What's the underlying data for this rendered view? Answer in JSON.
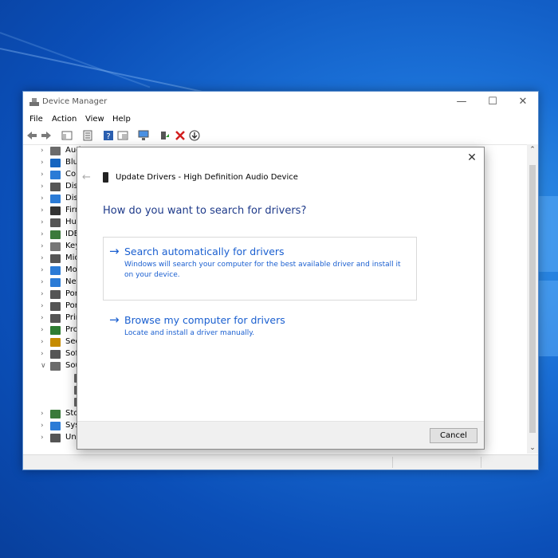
{
  "window": {
    "title": "Device Manager",
    "menu": [
      "File",
      "Action",
      "View",
      "Help"
    ]
  },
  "tree": [
    {
      "label": "Aud",
      "chev": ">",
      "icon": "speaker-icon",
      "color": "#6b6b6b"
    },
    {
      "label": "Blu",
      "chev": ">",
      "icon": "bluetooth-icon",
      "color": "#1565c0"
    },
    {
      "label": "Cor",
      "chev": ">",
      "icon": "monitor-icon",
      "color": "#2b7bd6"
    },
    {
      "label": "Disl",
      "chev": ">",
      "icon": "disk-icon",
      "color": "#555555"
    },
    {
      "label": "Disp",
      "chev": ">",
      "icon": "display-icon",
      "color": "#2b7bd6"
    },
    {
      "label": "Firm",
      "chev": ">",
      "icon": "firmware-icon",
      "color": "#333333"
    },
    {
      "label": "Hun",
      "chev": ">",
      "icon": "hid-icon",
      "color": "#555555"
    },
    {
      "label": "IDE",
      "chev": ">",
      "icon": "ide-icon",
      "color": "#3a7a3a"
    },
    {
      "label": "Key",
      "chev": ">",
      "icon": "keyboard-icon",
      "color": "#777777"
    },
    {
      "label": "Mic",
      "chev": ">",
      "icon": "mouse-icon",
      "color": "#555555"
    },
    {
      "label": "Mo",
      "chev": ">",
      "icon": "monitor-icon",
      "color": "#2b7bd6"
    },
    {
      "label": "Net",
      "chev": ">",
      "icon": "network-icon",
      "color": "#2b7bd6"
    },
    {
      "label": "Por",
      "chev": ">",
      "icon": "port-icon",
      "color": "#555555"
    },
    {
      "label": "Por",
      "chev": ">",
      "icon": "device-icon",
      "color": "#555555"
    },
    {
      "label": "Prir",
      "chev": ">",
      "icon": "printer-icon",
      "color": "#555555"
    },
    {
      "label": "Pro",
      "chev": ">",
      "icon": "processor-icon",
      "color": "#2e7d32"
    },
    {
      "label": "Sec",
      "chev": ">",
      "icon": "security-icon",
      "color": "#c58b00"
    },
    {
      "label": "Sof",
      "chev": ">",
      "icon": "software-icon",
      "color": "#555555"
    },
    {
      "label": "Sou",
      "chev": "v",
      "icon": "speaker-icon",
      "color": "#6b6b6b"
    },
    {
      "label": "",
      "chev": "",
      "icon": "speaker-icon",
      "color": "#6b6b6b",
      "indent": true
    },
    {
      "label": "",
      "chev": "",
      "icon": "speaker-icon",
      "color": "#6b6b6b",
      "indent": true
    },
    {
      "label": "",
      "chev": "",
      "icon": "speaker-icon",
      "color": "#6b6b6b",
      "indent": true
    },
    {
      "label": "Sto",
      "chev": ">",
      "icon": "storage-icon",
      "color": "#3a7a3a"
    },
    {
      "label": "Sys",
      "chev": ">",
      "icon": "system-icon",
      "color": "#2b7bd6"
    },
    {
      "label": "Uni",
      "chev": ">",
      "icon": "usb-icon",
      "color": "#555555"
    }
  ],
  "dialog": {
    "header": "Update Drivers - High Definition Audio Device",
    "question": "How do you want to search for drivers?",
    "options": [
      {
        "title": "Search automatically for drivers",
        "desc": "Windows will search your computer for the best available driver and install it on your device."
      },
      {
        "title": "Browse my computer for drivers",
        "desc": "Locate and install a driver manually."
      }
    ],
    "cancel": "Cancel"
  },
  "colors": {
    "accent": "#1a5fd0",
    "question": "#1e3a8a",
    "desktop": "#0b4fb8"
  }
}
